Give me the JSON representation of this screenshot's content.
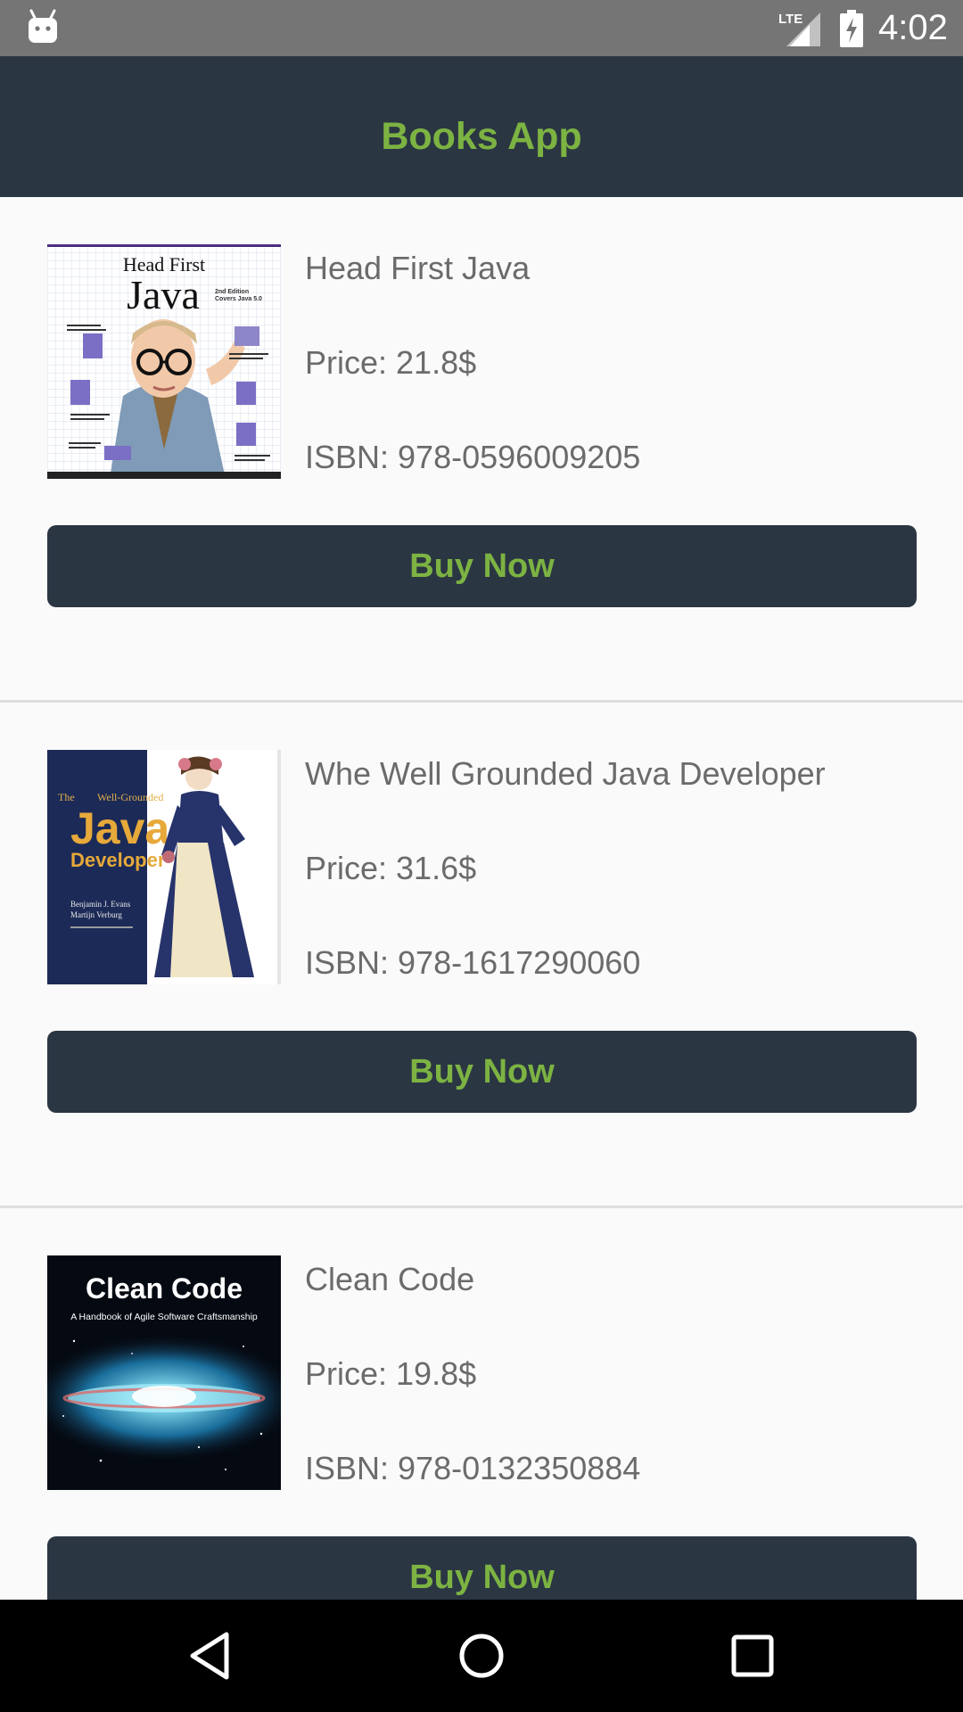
{
  "status_bar": {
    "time": "4:02",
    "network_label": "LTE",
    "icons": [
      "android-icon",
      "lte-signal-icon",
      "battery-charging-icon"
    ]
  },
  "app_bar": {
    "title": "Books App"
  },
  "books": [
    {
      "title": "Head First Java",
      "price": "Price: 21.8$",
      "isbn": "ISBN: 978-0596009205",
      "button_label": "Buy Now",
      "cover": {
        "lines": [
          "Head First",
          "Java",
          "2nd Edition",
          "Covers Java 5.0"
        ]
      }
    },
    {
      "title": "Whe Well Grounded Java Developer",
      "price": "Price: 31.6$",
      "isbn": "ISBN: 978-1617290060",
      "button_label": "Buy Now",
      "cover": {
        "lines": [
          "The",
          "Well-Grounded",
          "Java",
          "Developer",
          "Benjamin J. Evans",
          "Martijn Verburg"
        ]
      }
    },
    {
      "title": "Clean Code",
      "price": "Price: 19.8$",
      "isbn": "ISBN: 978-0132350884",
      "button_label": "Buy Now",
      "cover": {
        "lines": [
          "Clean Code",
          "A Handbook of Agile Software Craftsmanship"
        ]
      }
    }
  ],
  "nav_bar": {
    "icons": [
      "back-icon",
      "home-icon",
      "recents-icon"
    ]
  },
  "colors": {
    "primary_dark": "#2b3643",
    "accent_green": "#7cb342",
    "status_bar": "#757575",
    "background": "#fafafa",
    "text_gray": "#6b6b6b"
  }
}
